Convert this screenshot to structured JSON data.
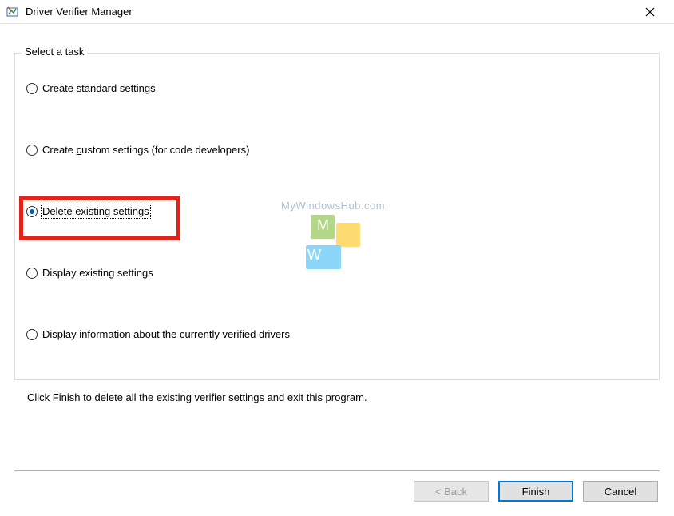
{
  "titlebar": {
    "title": "Driver Verifier Manager"
  },
  "groupbox": {
    "legend": "Select a task"
  },
  "radios": {
    "create_standard": {
      "label_pre": "Create ",
      "accel": "s",
      "label_post": "tandard settings",
      "selected": false
    },
    "create_custom": {
      "label_pre": "Create ",
      "accel": "c",
      "label_post": "ustom settings (for code developers)",
      "selected": false
    },
    "delete_existing": {
      "label_pre": "",
      "accel": "D",
      "label_post": "elete existing settings",
      "selected": true
    },
    "display_existing": {
      "label_pre": "Display existing settings",
      "accel": "",
      "label_post": "",
      "selected": false
    },
    "display_info": {
      "label_pre": "Display information about the currently verified drivers",
      "accel": "",
      "label_post": "",
      "selected": false
    }
  },
  "instruction": "Click Finish to delete all the existing verifier settings and exit this program.",
  "buttons": {
    "back": "< Back",
    "finish": "Finish",
    "cancel": "Cancel"
  },
  "watermark": {
    "text": "MyWindowsHub.com"
  }
}
